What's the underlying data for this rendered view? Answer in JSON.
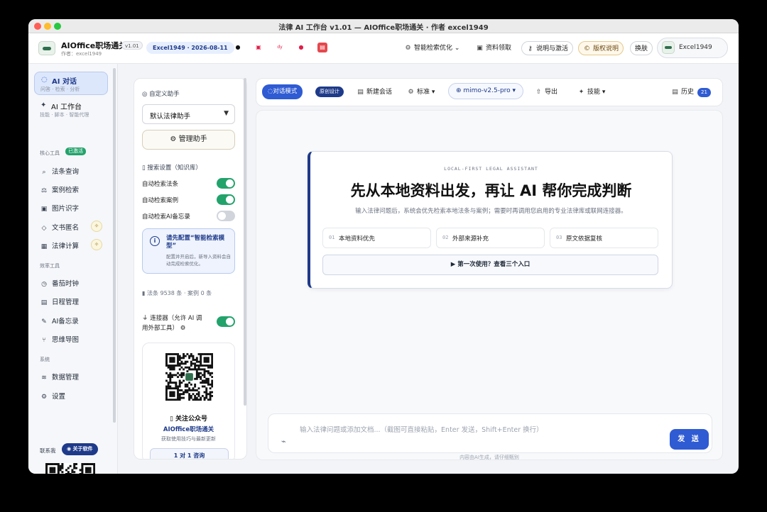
{
  "window": {
    "title": "法律 AI 工作台 v1.01 — AIOffice职场通关 · 作者 excel1949"
  },
  "header": {
    "brand": "AIOffice职场通关",
    "author": "作者：excel1949",
    "version": "v1.01",
    "user_pill": "Excel1949 · 2026-08-11",
    "social_icons": [
      "github-icon",
      "bilibili-icon",
      "douyin-icon",
      "weibo-icon",
      "xiaohongshu-icon"
    ],
    "social_glyphs": [
      "●",
      "▣",
      "dy",
      "●",
      "▤"
    ],
    "menu": {
      "search_opt": "智能检索优化",
      "resources": "资料领取",
      "activate": "说明与激活",
      "copyright": "版权说明",
      "skin": "换肤"
    },
    "user": "Excel1949"
  },
  "sidebar": {
    "ai_chat": {
      "title": "AI 对话",
      "sub": "问答 · 检索 · 分析"
    },
    "ai_workbench": {
      "title": "AI 工作台",
      "sub": "技能 · 脚本 · 智能代理"
    },
    "core_tools_label": "核心工具",
    "activated": "已激活",
    "core_tools": [
      "法条查询",
      "案例检索",
      "图片识字",
      "文书匿名",
      "法律计算"
    ],
    "efficiency_label": "效率工具",
    "efficiency_tools": [
      "番茄时钟",
      "日程管理",
      "AI备忘录",
      "思维导图"
    ],
    "system_label": "系统",
    "system_tools": [
      "数据管理",
      "设置"
    ],
    "contact": "联系我",
    "about": "关于软件"
  },
  "assistant_panel": {
    "custom_label": "自定义助手",
    "selected_assistant": "默认法律助手",
    "manage_button": "管理助手",
    "search_label": "搜索设置（知识库）",
    "toggles": [
      {
        "label": "自动检索法条",
        "on": true
      },
      {
        "label": "自动检索案例",
        "on": true
      },
      {
        "label": "自动检索AI备忘录",
        "on": false
      }
    ],
    "notice_title": "请先配置“智能检索模型”",
    "notice_desc": "配置并开启后，新导入资料会自动完成检索优化。",
    "stats": "法条 9538 条 · 案例 0 条",
    "connector": "连接器（允许 AI 调用外部工具）",
    "connector_on": true,
    "follow_title": "关注公众号",
    "follow_name": "AIOffice职场通关",
    "follow_desc": "获取使用技巧与最新更新",
    "consult_button": "1 对 1 咨询"
  },
  "toolbar": {
    "chat_mode": "对话模式",
    "original": "原创设计",
    "new_chat": "新建会话",
    "standard": "标准",
    "model": "mimo-v2.5-pro",
    "export": "导出",
    "skills": "技能",
    "history": "历史",
    "history_count": "21"
  },
  "hero": {
    "eyebrow": "LOCAL-FIRST LEGAL ASSISTANT",
    "title": "先从本地资料出发，再让 AI 帮你完成判断",
    "subtitle": "输入法律问题后，系统会优先检索本地法条与案例；需要时再调用您启用的专业法律库或联网连接器。",
    "steps": [
      {
        "num": "01",
        "label": "本地资料优先"
      },
      {
        "num": "02",
        "label": "外部来源补充"
      },
      {
        "num": "03",
        "label": "原文依据复核"
      }
    ],
    "guide": "▶ 第一次使用？查看三个入口"
  },
  "composer": {
    "placeholder": "输入法律问题或添加文档...（截图可直接粘贴，Enter 发送，Shift+Enter 换行）",
    "send": "发 送",
    "disclaimer": "内容由AI生成，请仔细甄别"
  }
}
